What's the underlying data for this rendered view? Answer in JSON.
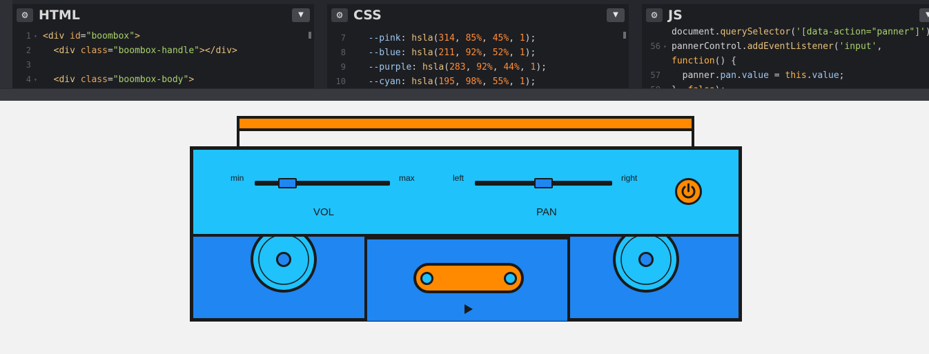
{
  "editor": {
    "panes": [
      {
        "title": "HTML",
        "lines": [
          {
            "n": "1",
            "fold": true,
            "tokens": [
              [
                "t-tag",
                "<div "
              ],
              [
                "t-attr",
                "id"
              ],
              [
                "t-punc",
                "="
              ],
              [
                "t-str",
                "\"boombox\""
              ],
              [
                "t-tag",
                ">"
              ]
            ]
          },
          {
            "n": "2",
            "fold": false,
            "tokens": [
              [
                "t-punc",
                "  "
              ],
              [
                "t-tag",
                "<div "
              ],
              [
                "t-attr",
                "class"
              ],
              [
                "t-punc",
                "="
              ],
              [
                "t-str",
                "\"boombox-handle\""
              ],
              [
                "t-tag",
                "></div>"
              ]
            ]
          },
          {
            "n": "3",
            "fold": false,
            "tokens": []
          },
          {
            "n": "4",
            "fold": true,
            "tokens": [
              [
                "t-punc",
                "  "
              ],
              [
                "t-tag",
                "<div "
              ],
              [
                "t-attr",
                "class"
              ],
              [
                "t-punc",
                "="
              ],
              [
                "t-str",
                "\"boombox-body\""
              ],
              [
                "t-tag",
                ">"
              ]
            ]
          }
        ]
      },
      {
        "title": "CSS",
        "lines": [
          {
            "n": "7",
            "fold": false,
            "tokens": [
              [
                "t-punc",
                "  "
              ],
              [
                "t-prop",
                "--pink"
              ],
              [
                "t-punc",
                ": "
              ],
              [
                "t-fn",
                "hsla"
              ],
              [
                "t-punc",
                "("
              ],
              [
                "t-num",
                "314"
              ],
              [
                "t-punc",
                ", "
              ],
              [
                "t-num",
                "85%"
              ],
              [
                "t-punc",
                ", "
              ],
              [
                "t-num",
                "45%"
              ],
              [
                "t-punc",
                ", "
              ],
              [
                "t-num",
                "1"
              ],
              [
                "t-punc",
                ");"
              ]
            ]
          },
          {
            "n": "8",
            "fold": false,
            "tokens": [
              [
                "t-punc",
                "  "
              ],
              [
                "t-prop",
                "--blue"
              ],
              [
                "t-punc",
                ": "
              ],
              [
                "t-fn",
                "hsla"
              ],
              [
                "t-punc",
                "("
              ],
              [
                "t-num",
                "211"
              ],
              [
                "t-punc",
                ", "
              ],
              [
                "t-num",
                "92%"
              ],
              [
                "t-punc",
                ", "
              ],
              [
                "t-num",
                "52%"
              ],
              [
                "t-punc",
                ", "
              ],
              [
                "t-num",
                "1"
              ],
              [
                "t-punc",
                ");"
              ]
            ]
          },
          {
            "n": "9",
            "fold": false,
            "tokens": [
              [
                "t-punc",
                "  "
              ],
              [
                "t-prop",
                "--purple"
              ],
              [
                "t-punc",
                ": "
              ],
              [
                "t-fn",
                "hsla"
              ],
              [
                "t-punc",
                "("
              ],
              [
                "t-num",
                "283"
              ],
              [
                "t-punc",
                ", "
              ],
              [
                "t-num",
                "92%"
              ],
              [
                "t-punc",
                ", "
              ],
              [
                "t-num",
                "44%"
              ],
              [
                "t-punc",
                ", "
              ],
              [
                "t-num",
                "1"
              ],
              [
                "t-punc",
                ");"
              ]
            ]
          },
          {
            "n": "10",
            "fold": false,
            "tokens": [
              [
                "t-punc",
                "  "
              ],
              [
                "t-prop",
                "--cyan"
              ],
              [
                "t-punc",
                ": "
              ],
              [
                "t-fn",
                "hsla"
              ],
              [
                "t-punc",
                "("
              ],
              [
                "t-num",
                "195"
              ],
              [
                "t-punc",
                ", "
              ],
              [
                "t-num",
                "98%"
              ],
              [
                "t-punc",
                ", "
              ],
              [
                "t-num",
                "55%"
              ],
              [
                "t-punc",
                ", "
              ],
              [
                "t-num",
                "1"
              ],
              [
                "t-punc",
                ");"
              ]
            ]
          }
        ]
      },
      {
        "title": "JS",
        "lines": [
          {
            "n": "",
            "fold": false,
            "tokens": [
              [
                "t-punc",
                "document."
              ],
              [
                "t-fn",
                "querySelector"
              ],
              [
                "t-punc",
                "("
              ],
              [
                "t-str",
                "'[data-action=\"panner\"]'"
              ],
              [
                "t-punc",
                ");"
              ]
            ]
          },
          {
            "n": "56",
            "fold": true,
            "tokens": [
              [
                "t-punc",
                "pannerControl."
              ],
              [
                "t-fn",
                "addEventListener"
              ],
              [
                "t-punc",
                "("
              ],
              [
                "t-str",
                "'input'"
              ],
              [
                "t-punc",
                ","
              ]
            ]
          },
          {
            "n": "",
            "fold": false,
            "tokens": [
              [
                "t-kw",
                "function"
              ],
              [
                "t-punc",
                "() {"
              ]
            ]
          },
          {
            "n": "57",
            "fold": false,
            "tokens": [
              [
                "t-punc",
                "  panner."
              ],
              [
                "t-prop",
                "pan"
              ],
              [
                "t-punc",
                "."
              ],
              [
                "t-prop",
                "value"
              ],
              [
                "t-punc",
                " = "
              ],
              [
                "t-kw",
                "this"
              ],
              [
                "t-punc",
                "."
              ],
              [
                "t-prop",
                "value"
              ],
              [
                "t-punc",
                ";"
              ]
            ]
          },
          {
            "n": "58",
            "fold": false,
            "tokens": [
              [
                "t-punc",
                "}, "
              ],
              [
                "t-kw",
                "false"
              ],
              [
                "t-punc",
                ");"
              ]
            ]
          }
        ]
      }
    ]
  },
  "boombox": {
    "volume": {
      "min_label": "min",
      "max_label": "max",
      "label": "VOL",
      "value": 0.2
    },
    "pan": {
      "left_label": "left",
      "right_label": "right",
      "label": "PAN",
      "value": 0.5
    },
    "colors": {
      "orange": "#ff8a00",
      "cyan": "#1fc2fb",
      "blue": "#1f86f2",
      "outline": "#1a1a1a"
    },
    "power_icon": "power-icon",
    "play_icon": "play-icon"
  }
}
